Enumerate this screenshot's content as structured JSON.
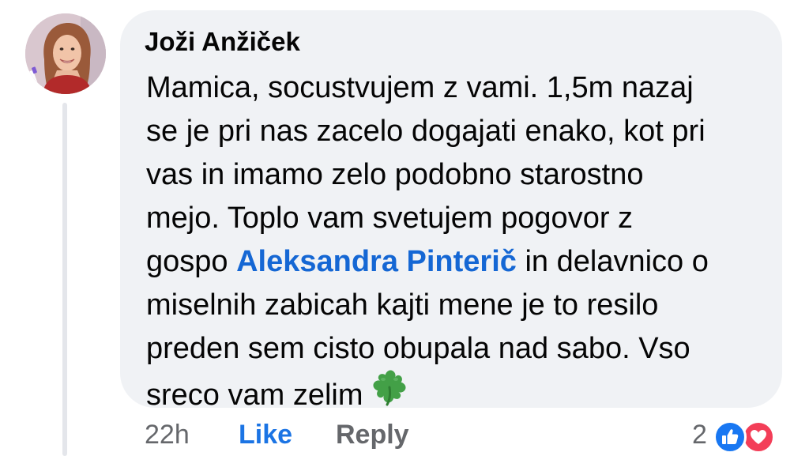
{
  "comment": {
    "author": "Joži Anžiček",
    "text_lines": [
      [
        "Mamica, socustvujem z vami. 1,5m nazaj"
      ],
      [
        "se je pri nas zacelo dogajati enako, kot pri"
      ],
      [
        "vas in imamo zelo podobno starostno"
      ],
      [
        "mejo. Toplo vam svetujem pogovor z"
      ],
      [
        "gospo ",
        "Aleksandra Pinterič",
        " in delavnico o"
      ],
      [
        "miselnih zabicah kajti mene je to resilo"
      ],
      [
        "preden sem cisto obupala nad sabo. Vso"
      ],
      [
        "sreco vam zelim"
      ]
    ],
    "line_1": "Mamica, socustvujem z vami. 1,5m nazaj",
    "line_2": "se je pri nas zacelo dogajati enako, kot pri",
    "line_3": "vas in imamo zelo podobno starostno",
    "line_4": "mejo. Toplo vam svetujem pogovor z",
    "line_5_before": "gospo ",
    "mention": "Aleksandra Pinterič",
    "line_5_after": " in delavnico o",
    "line_6": "miselnih zabicah kajti mene je to resilo",
    "line_7": "preden sem cisto obupala nad sabo. Vso",
    "line_8": "sreco vam zelim",
    "emoji": "four-leaf-clover-icon"
  },
  "actions": {
    "time": "22h",
    "like_label": "Like",
    "reply_label": "Reply"
  },
  "reactions": {
    "count": "2",
    "types": [
      "like-reaction-icon",
      "love-reaction-icon"
    ],
    "like_color": "#1877f2",
    "love_color": "#f33e58"
  },
  "colors": {
    "bubble": "#f0f2f5",
    "mention": "#1567d4",
    "link": "#1b74e4",
    "muted": "#65676b"
  }
}
